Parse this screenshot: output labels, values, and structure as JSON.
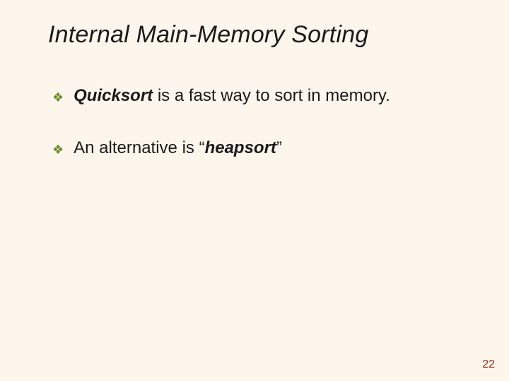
{
  "title": "Internal Main-Memory Sorting",
  "bullets": [
    {
      "term": "Quicksort",
      "rest": " is a fast way to sort in memory."
    },
    {
      "pre": "An alternative is “",
      "term": "heapsort",
      "post": "”"
    }
  ],
  "page_number": "22",
  "icons": {
    "diamond": "❖"
  }
}
